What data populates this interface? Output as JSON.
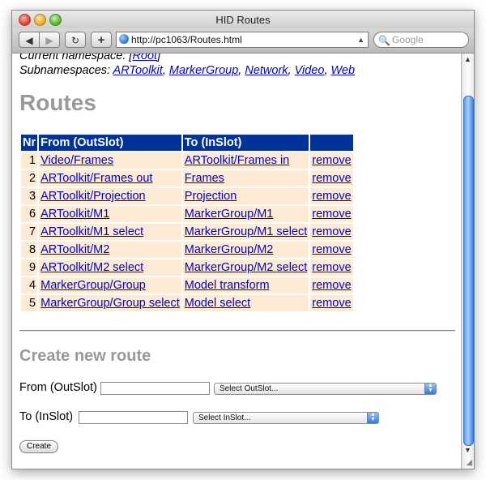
{
  "window": {
    "title": "HID Routes"
  },
  "toolbar": {
    "back_icon": "◀",
    "forward_icon": "▶",
    "reload_icon": "↻",
    "add_icon": "+",
    "url": "http://pc1063/Routes.html",
    "search_placeholder": "Google",
    "search_icon": "🔍"
  },
  "namespace": {
    "current_label": "Current namespace: [",
    "current_link": "Root",
    "current_close": "]",
    "sub_label": "Subnamespaces:",
    "sub_links": [
      "ARToolkit",
      "MarkerGroup",
      "Network",
      "Video",
      "Web"
    ]
  },
  "routes": {
    "heading": "Routes",
    "columns": [
      "Nr",
      "From (OutSlot)",
      "To (InSlot)",
      ""
    ],
    "rows": [
      {
        "nr": "1",
        "from": "Video/Frames",
        "to": "ARToolkit/Frames in",
        "action": "remove"
      },
      {
        "nr": "2",
        "from": "ARToolkit/Frames out",
        "to": "Frames",
        "action": "remove"
      },
      {
        "nr": "3",
        "from": "ARToolkit/Projection",
        "to": "Projection",
        "action": "remove"
      },
      {
        "nr": "6",
        "from": "ARToolkit/M1",
        "to": "MarkerGroup/M1",
        "action": "remove"
      },
      {
        "nr": "7",
        "from": "ARToolkit/M1 select",
        "to": "MarkerGroup/M1 select",
        "action": "remove"
      },
      {
        "nr": "8",
        "from": "ARToolkit/M2",
        "to": "MarkerGroup/M2",
        "action": "remove"
      },
      {
        "nr": "9",
        "from": "ARToolkit/M2 select",
        "to": "MarkerGroup/M2 select",
        "action": "remove"
      },
      {
        "nr": "4",
        "from": "MarkerGroup/Group",
        "to": "Model transform",
        "action": "remove"
      },
      {
        "nr": "5",
        "from": "MarkerGroup/Group select",
        "to": "Model select",
        "action": "remove"
      }
    ]
  },
  "create": {
    "heading": "Create new route",
    "from_label": "From (OutSlot)",
    "from_value": "",
    "from_select": "Select OutSlot...",
    "to_label": "To (InSlot)",
    "to_value": "",
    "to_select": "Select InSlot...",
    "button": "Create"
  }
}
